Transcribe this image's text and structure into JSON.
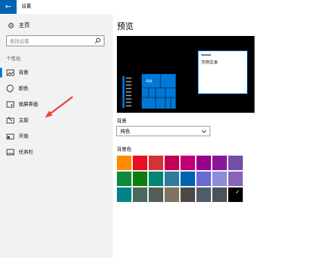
{
  "window": {
    "title": "设置",
    "back_glyph": "←"
  },
  "sidebar": {
    "home_label": "主页",
    "search_placeholder": "查找设置",
    "section": "个性化",
    "items": [
      {
        "label": "背景",
        "icon": "image-icon",
        "active": true
      },
      {
        "label": "颜色",
        "icon": "palette-icon",
        "active": false
      },
      {
        "label": "锁屏界面",
        "icon": "lockscreen-icon",
        "active": false
      },
      {
        "label": "主题",
        "icon": "theme-icon",
        "active": false
      },
      {
        "label": "开始",
        "icon": "start-icon",
        "active": false
      },
      {
        "label": "任务栏",
        "icon": "taskbar-icon",
        "active": false
      }
    ]
  },
  "main": {
    "title": "预览",
    "preview": {
      "sample_text": "示例文本",
      "tile_text": "Aa"
    },
    "background_label": "背景",
    "background_value": "纯色",
    "color_label": "背景色",
    "colors": [
      "#ff8c00",
      "#e81123",
      "#d13438",
      "#c30052",
      "#bf0077",
      "#9a0089",
      "#881798",
      "#744da9",
      "#10893e",
      "#107c10",
      "#018574",
      "#2d7d9a",
      "#0063b1",
      "#6b69d6",
      "#8e8cd8",
      "#8764b8",
      "#038387",
      "#486860",
      "#525e54",
      "#7e735f",
      "#4c4a48",
      "#515c6b",
      "#4a5459",
      "#000000"
    ],
    "selected_color_index": 23,
    "selected_check": "✓"
  }
}
